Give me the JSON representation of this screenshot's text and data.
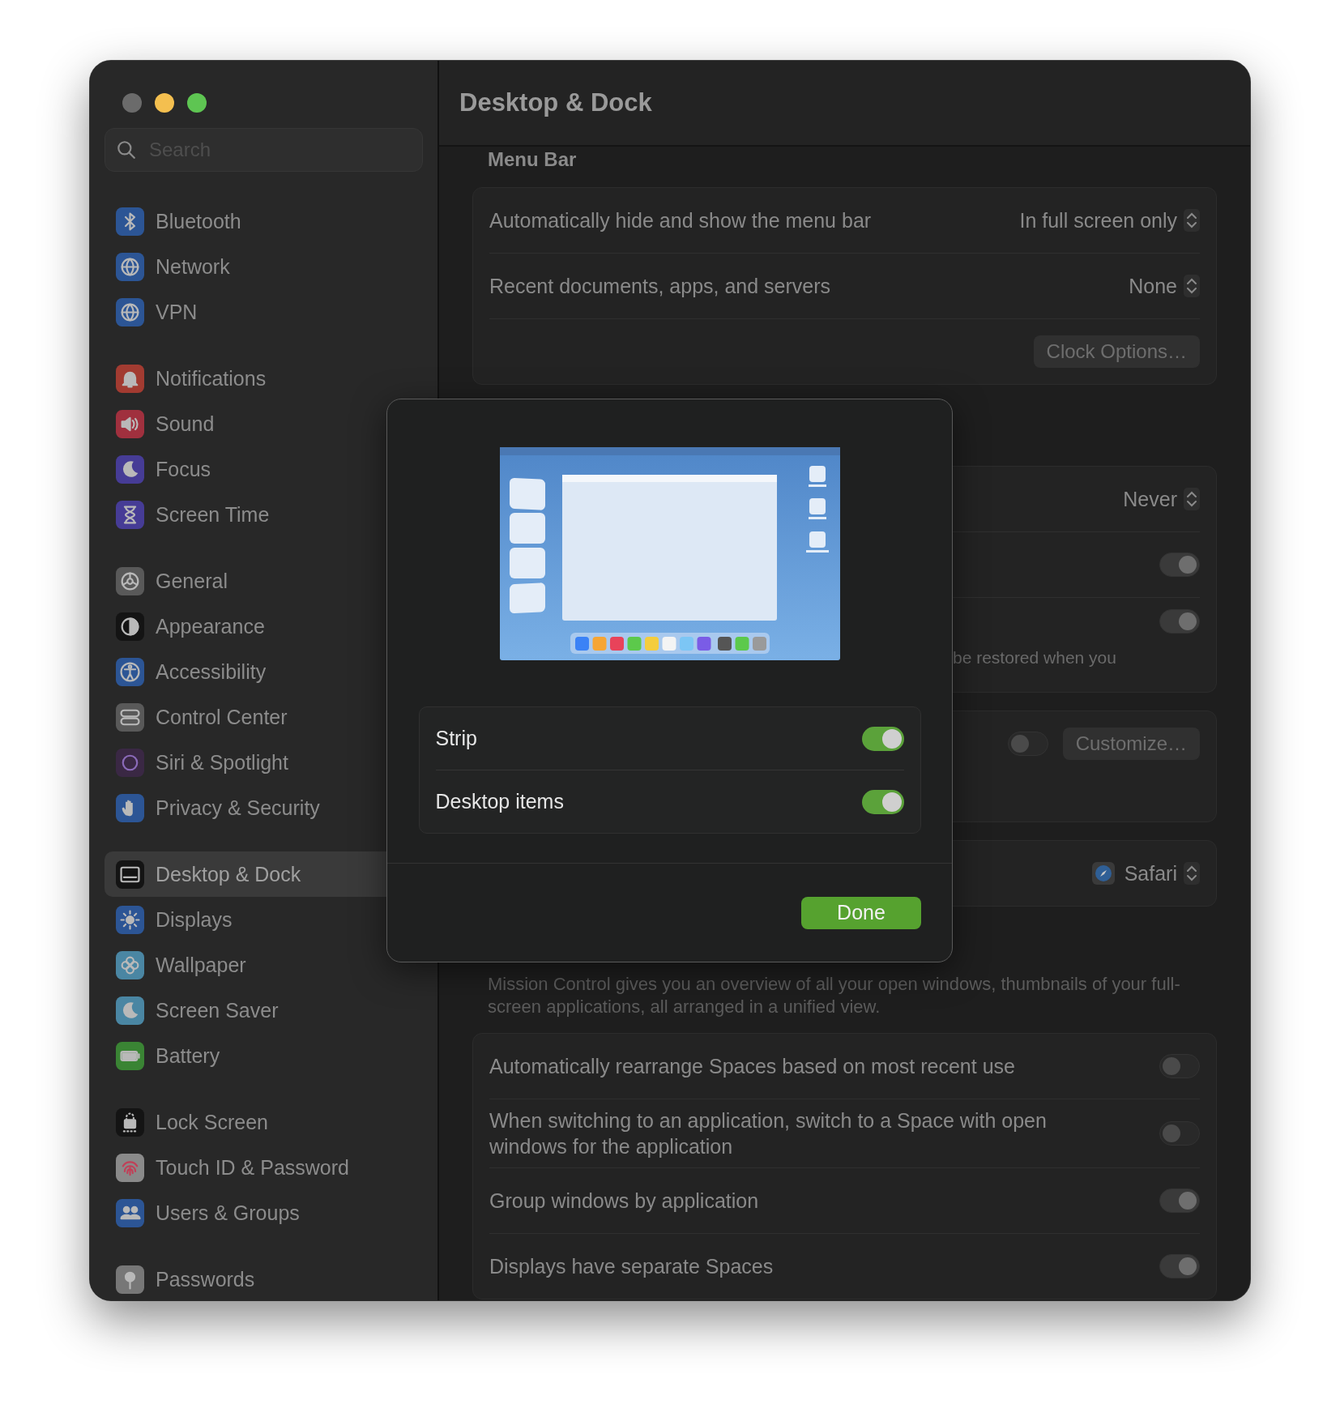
{
  "window": {
    "controls": [
      {
        "color": "#6b6b6b"
      },
      {
        "color": "#f4bf4f"
      },
      {
        "color": "#5ec552"
      }
    ]
  },
  "sidebar": {
    "search": {
      "placeholder": "Search"
    },
    "groups": [
      {
        "items": [
          {
            "label": "Bluetooth",
            "color": "#2c5595",
            "selected": false
          },
          {
            "label": "Network",
            "color": "#2c5595",
            "selected": false
          },
          {
            "label": "VPN",
            "color": "#2c5595",
            "selected": false
          }
        ]
      },
      {
        "items": [
          {
            "label": "Notifications",
            "color": "#a23b31",
            "selected": false
          },
          {
            "label": "Sound",
            "color": "#a0303e",
            "selected": false
          },
          {
            "label": "Focus",
            "color": "#463c96",
            "selected": false
          },
          {
            "label": "Screen Time",
            "color": "#463c96",
            "selected": false
          }
        ]
      },
      {
        "items": [
          {
            "label": "General",
            "color": "#595959",
            "selected": false
          },
          {
            "label": "Appearance",
            "color": "#141414",
            "selected": false
          },
          {
            "label": "Accessibility",
            "color": "#2c5595",
            "selected": false
          },
          {
            "label": "Control Center",
            "color": "#595959",
            "selected": false
          },
          {
            "label": "Siri & Spotlight",
            "color": "#3a2844",
            "selected": false
          },
          {
            "label": "Privacy & Security",
            "color": "#2c5595",
            "selected": false
          }
        ]
      },
      {
        "items": [
          {
            "label": "Desktop & Dock",
            "color": "#141414",
            "selected": true
          },
          {
            "label": "Displays",
            "color": "#2c5595",
            "selected": false
          },
          {
            "label": "Wallpaper",
            "color": "#4a86a3",
            "selected": false
          },
          {
            "label": "Screen Saver",
            "color": "#4a86a3",
            "selected": false
          },
          {
            "label": "Battery",
            "color": "#3a8434",
            "selected": false
          }
        ]
      },
      {
        "items": [
          {
            "label": "Lock Screen",
            "color": "#141414",
            "selected": false
          },
          {
            "label": "Touch ID & Password",
            "color": "#8a8a8a",
            "selected": false
          },
          {
            "label": "Users & Groups",
            "color": "#2c5595",
            "selected": false
          }
        ]
      },
      {
        "items": [
          {
            "label": "Passwords",
            "color": "#777777",
            "selected": false
          }
        ]
      }
    ]
  },
  "content": {
    "title": "Desktop & Dock",
    "sections": [
      {
        "heading": "Menu Bar",
        "rows": [
          {
            "kind": "popup",
            "label": "Automatically hide and show the menu bar",
            "value": "In full screen only"
          },
          {
            "kind": "popup",
            "label": "Recent documents, apps, and servers",
            "value": "None"
          },
          {
            "kind": "button",
            "button": "Clock Options…"
          }
        ]
      },
      {
        "rows": [
          {
            "kind": "popup",
            "value": "Never"
          },
          {
            "kind": "toggle",
            "on": true
          },
          {
            "kind": "toggle",
            "on": true,
            "description": "be restored when you"
          }
        ]
      },
      {
        "rows": [
          {
            "kind": "toggle_button",
            "on": false,
            "button": "Customize…"
          }
        ]
      },
      {
        "rows": [
          {
            "kind": "app_popup",
            "value": "Safari"
          }
        ]
      },
      {
        "description": "Mission Control gives you an overview of all your open windows, thumbnails of your full-screen applications, all arranged in a unified view.",
        "rows": [
          {
            "kind": "toggle",
            "label": "Automatically rearrange Spaces based on most recent use",
            "on": false
          },
          {
            "kind": "toggle",
            "label": "When switching to an application, switch to a Space with open windows for the application",
            "on": false
          },
          {
            "kind": "toggle",
            "label": "Group windows by application",
            "on": true
          },
          {
            "kind": "toggle",
            "label": "Displays have separate Spaces",
            "on": true
          }
        ]
      }
    ]
  },
  "sheet": {
    "options": [
      {
        "label": "Strip",
        "on": true
      },
      {
        "label": "Desktop items",
        "on": true
      }
    ],
    "done_button": "Done"
  }
}
